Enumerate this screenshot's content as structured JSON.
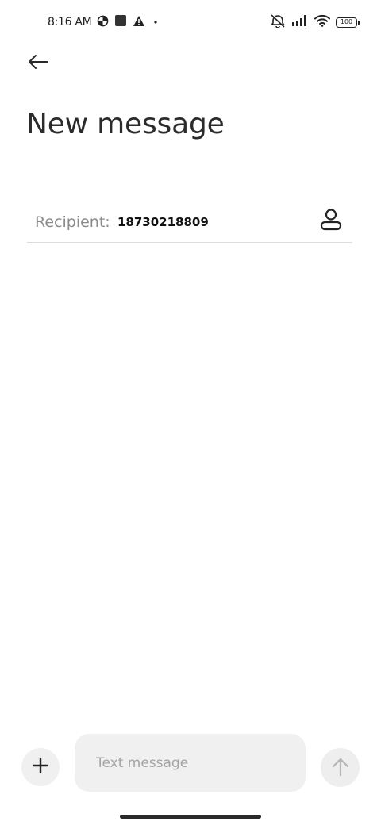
{
  "status_bar": {
    "time": "8:16 AM",
    "battery": "100",
    "icons": [
      "data-saver-icon",
      "square-notification-icon",
      "warning-icon",
      "dot-icon",
      "vibrate-off-icon",
      "signal-icon",
      "wifi-icon",
      "battery-icon"
    ]
  },
  "header": {
    "back_icon": "arrow-left-icon",
    "title": "New message"
  },
  "recipient": {
    "label": "Recipient:",
    "value": "18730218809",
    "contact_icon": "person-icon"
  },
  "compose": {
    "attach_icon": "plus-icon",
    "placeholder": "Text message",
    "send_icon": "arrow-up-icon"
  }
}
